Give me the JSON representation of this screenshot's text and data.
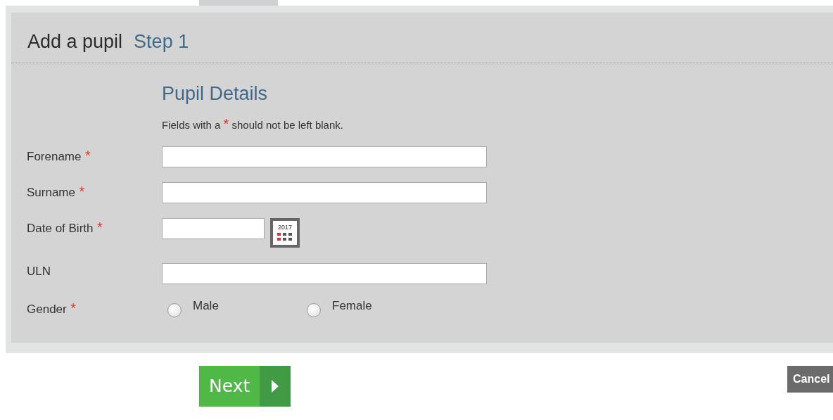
{
  "header": {
    "title": "Add a pupil",
    "step": "Step 1"
  },
  "section": {
    "title": "Pupil Details",
    "note_before": "Fields with a",
    "note_mark": "*",
    "note_after": "should not be left blank."
  },
  "fields": [
    {
      "kind": "text",
      "label": "Forename",
      "required": true,
      "mark": "*"
    },
    {
      "kind": "text",
      "label": "Surname",
      "required": true,
      "mark": "*"
    },
    {
      "kind": "date",
      "label": "Date of Birth",
      "required": true,
      "mark": "*",
      "calendar_year": "2017"
    },
    {
      "kind": "text",
      "label": "ULN",
      "required": false
    },
    {
      "kind": "radio",
      "label": "Gender",
      "required": true,
      "mark": "*",
      "options": [
        {
          "label": "Male",
          "selected": false
        },
        {
          "label": "Female",
          "selected": false
        }
      ]
    }
  ],
  "buttons": {
    "next": "Next",
    "cancel": "Cancel"
  }
}
